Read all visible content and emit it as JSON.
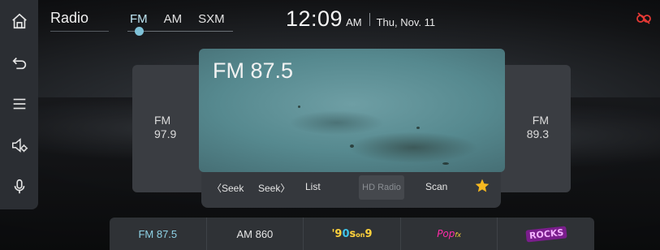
{
  "header": {
    "title": "Radio",
    "bands": [
      "FM",
      "AM",
      "SXM"
    ],
    "active_band": "FM",
    "time": "12:09",
    "ampm": "AM",
    "date": "Thu, Nov. 11"
  },
  "rail": {
    "icons": [
      "home-icon",
      "back-icon",
      "menu-icon",
      "volume-settings-icon",
      "microphone-icon"
    ]
  },
  "stations": {
    "previous": {
      "band": "FM",
      "freq": "97.9"
    },
    "current": "FM 87.5",
    "next": {
      "band": "FM",
      "freq": "89.3"
    }
  },
  "controls": {
    "seek_prev": "〈Seek",
    "seek_next": "Seek〉",
    "list": "List",
    "hd": "HD Radio",
    "scan": "Scan",
    "favorite_color": "#f6b820"
  },
  "presets": [
    {
      "label": "FM 87.5",
      "active": true
    },
    {
      "label": "AM 860"
    },
    {
      "label": "'90s on 9",
      "logo": "90s-logo"
    },
    {
      "label": "PopFX",
      "logo": "pop-logo"
    },
    {
      "label": "Rocks",
      "logo": "rocks-logo"
    }
  ],
  "colors": {
    "accent": "#7fc2d8",
    "status_icon": "#e53935"
  }
}
